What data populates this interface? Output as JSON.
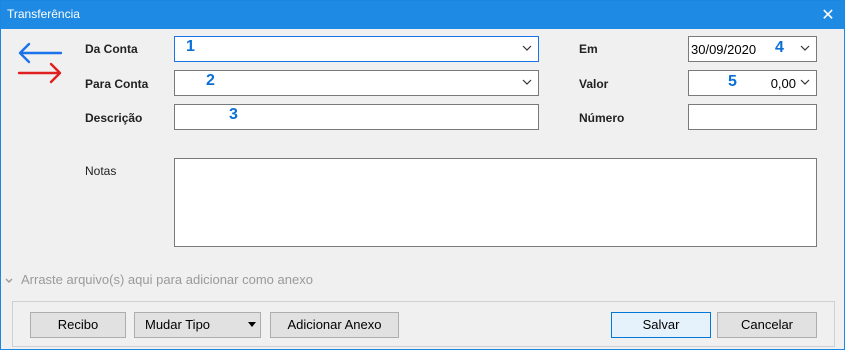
{
  "window": {
    "title": "Transferência",
    "close_label": "✕"
  },
  "form": {
    "from_account": {
      "label": "Da Conta",
      "value": "",
      "marker": "1"
    },
    "to_account": {
      "label": "Para Conta",
      "value": "",
      "marker": "2"
    },
    "description": {
      "label": "Descrição",
      "value": "",
      "marker": "3"
    },
    "date": {
      "label": "Em",
      "value": "30/09/2020",
      "marker": "4"
    },
    "amount": {
      "label": "Valor",
      "value": "0,00",
      "marker": "5"
    },
    "number": {
      "label": "Número",
      "value": ""
    },
    "notes": {
      "label": "Notas",
      "value": ""
    }
  },
  "attachments": {
    "hint": "Arraste arquivo(s) aqui para adicionar como anexo"
  },
  "buttons": {
    "receipt": "Recibo",
    "change_type": "Mudar Tipo",
    "add_attachment": "Adicionar Anexo",
    "save": "Salvar",
    "cancel": "Cancelar"
  },
  "icons": {
    "transfer": "transfer-arrows-icon",
    "close": "close-icon",
    "dropdown": "chevron-down-icon"
  },
  "colors": {
    "titlebar": "#1f8ae4",
    "marker": "#0a6fd6",
    "arrow_blue": "#1a73e8",
    "arrow_red": "#e02020"
  }
}
